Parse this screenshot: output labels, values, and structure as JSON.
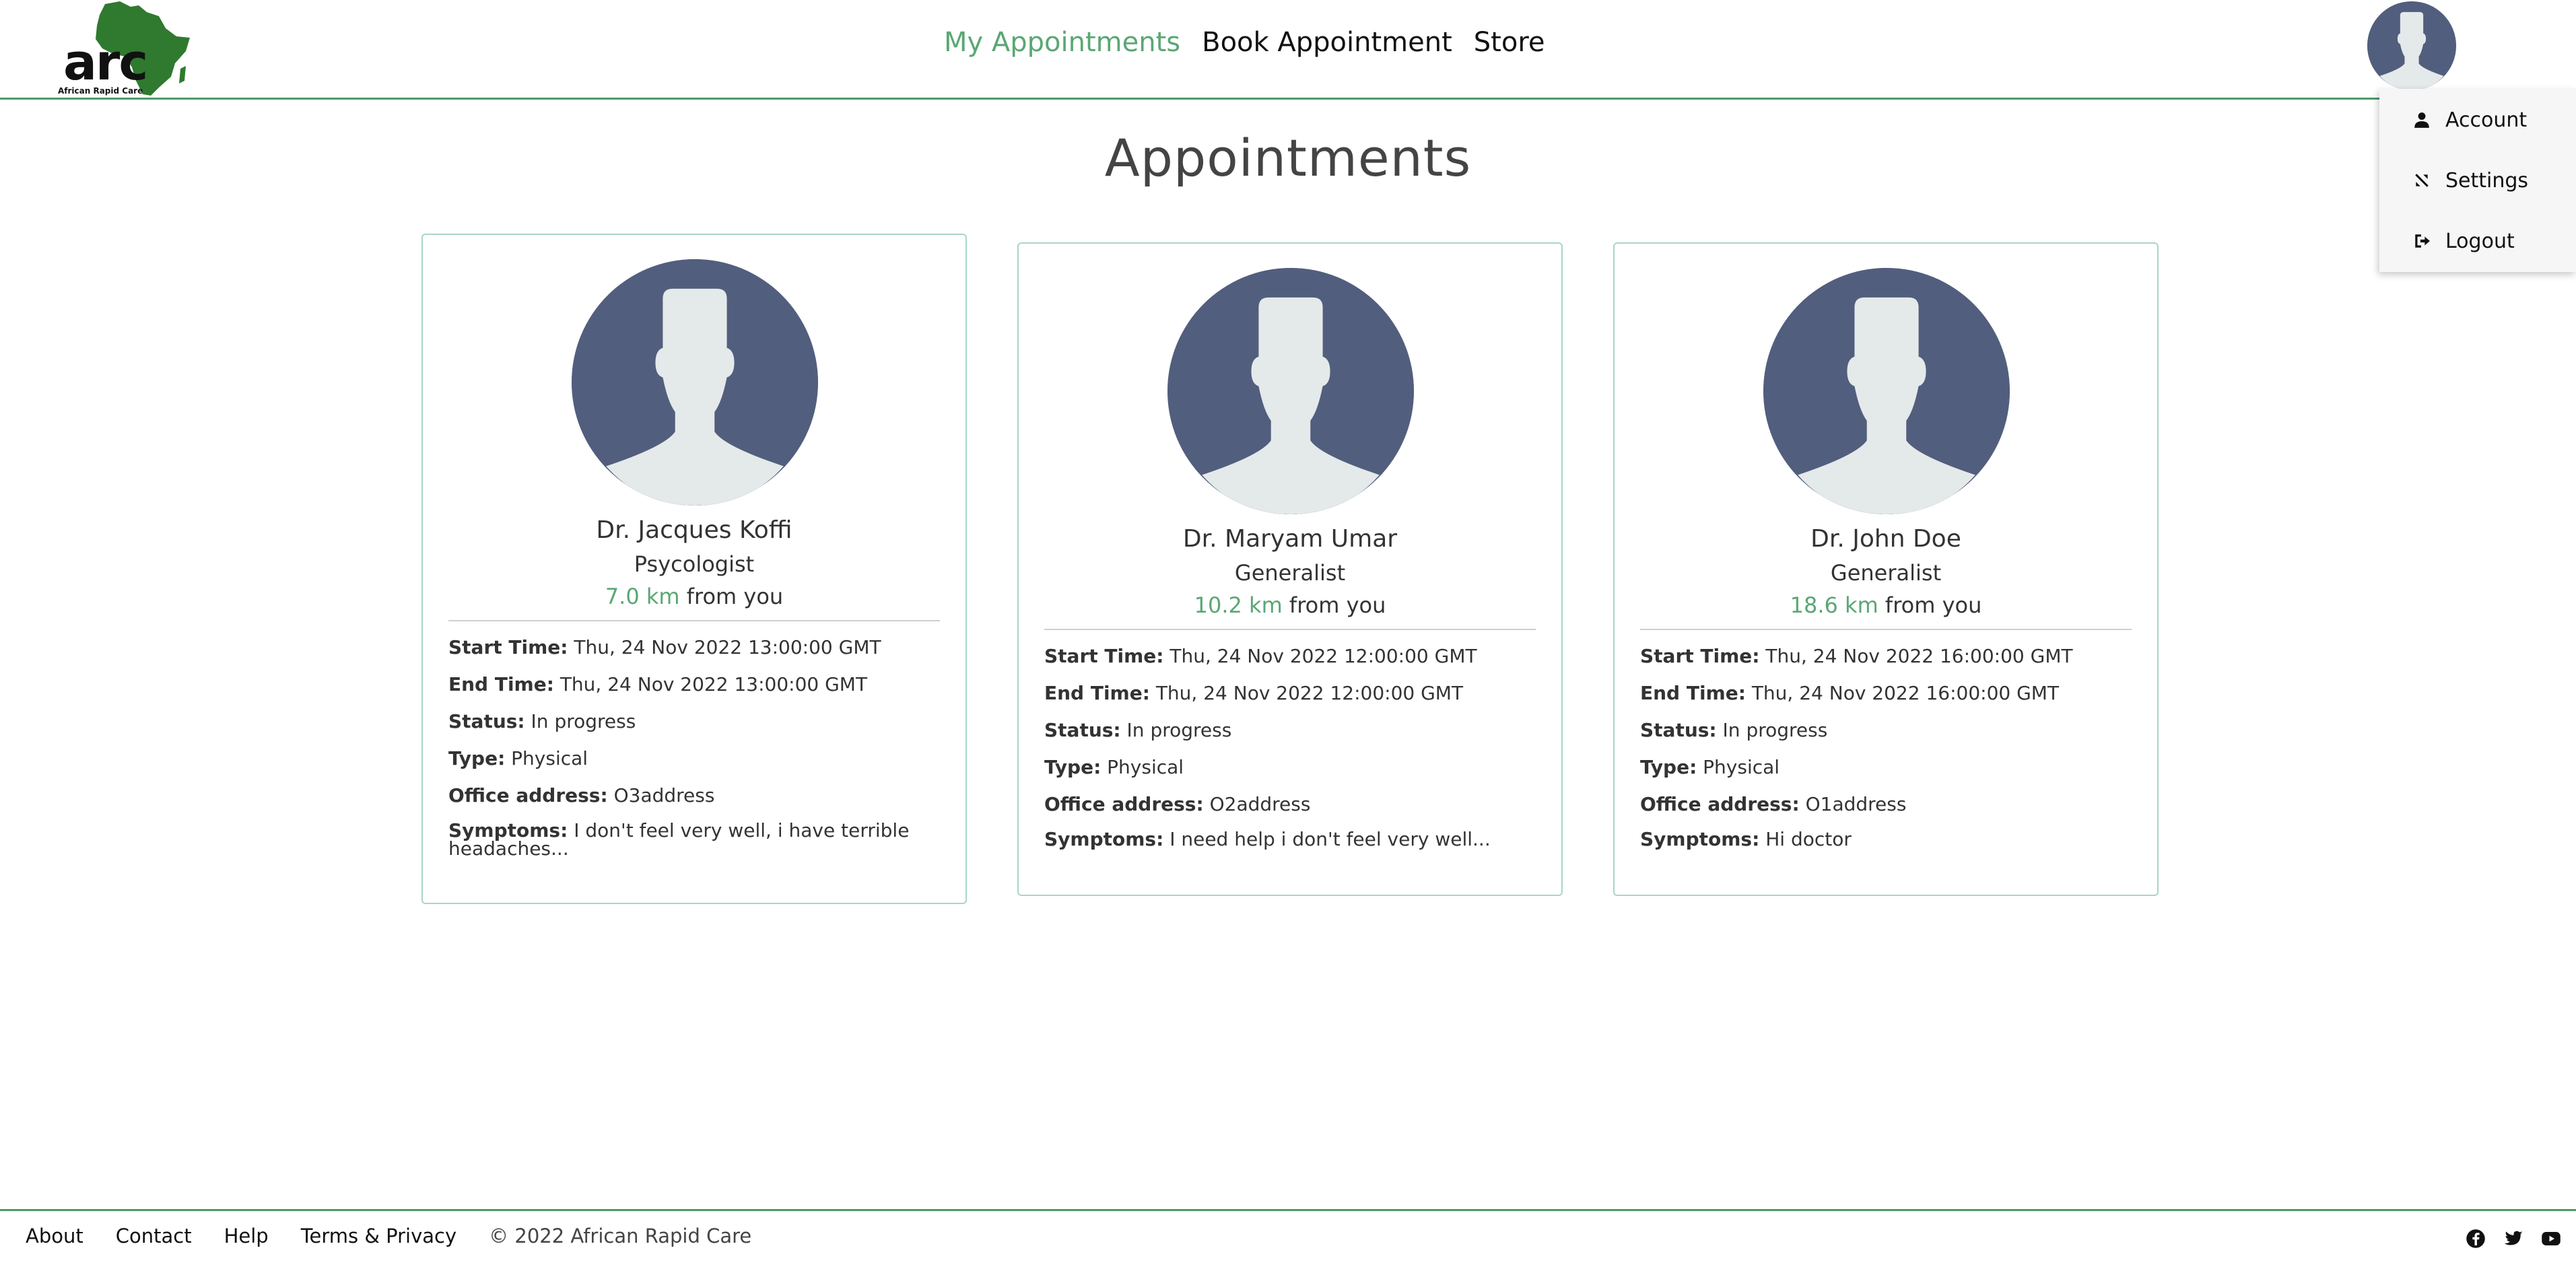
{
  "brand": {
    "logo_text": "arc",
    "logo_subtitle": "African Rapid Care",
    "accent_color": "#5aa774",
    "logo_color": "#2f7a2f"
  },
  "nav": {
    "items": [
      {
        "label": "My Appointments",
        "active": true
      },
      {
        "label": "Book Appointment",
        "active": false
      },
      {
        "label": "Store",
        "active": false
      }
    ]
  },
  "user_menu": {
    "items": [
      {
        "label": "Account",
        "icon": "user-icon"
      },
      {
        "label": "Settings",
        "icon": "tools-icon"
      },
      {
        "label": "Logout",
        "icon": "logout-icon"
      }
    ]
  },
  "page": {
    "title": "Appointments"
  },
  "labels": {
    "start_time": "Start Time:",
    "end_time": "End Time:",
    "status": "Status:",
    "type": "Type:",
    "office_address": "Office address:",
    "symptoms": "Symptoms:",
    "from_you": "from you"
  },
  "appointments": [
    {
      "doctor": "Dr. Jacques Koffi",
      "specialty": "Psycologist",
      "distance": "7.0 km",
      "start_time": "Thu, 24 Nov 2022 13:00:00 GMT",
      "end_time": "Thu, 24 Nov 2022 13:00:00 GMT",
      "status": "In progress",
      "type": "Physical",
      "office_address": "O3address",
      "symptoms": "I don't feel very well, i have terrible headaches..."
    },
    {
      "doctor": "Dr. Maryam Umar",
      "specialty": "Generalist",
      "distance": "10.2 km",
      "start_time": "Thu, 24 Nov 2022 12:00:00 GMT",
      "end_time": "Thu, 24 Nov 2022 12:00:00 GMT",
      "status": "In progress",
      "type": "Physical",
      "office_address": "O2address",
      "symptoms": "I need help i don't feel very well..."
    },
    {
      "doctor": "Dr. John Doe",
      "specialty": "Generalist",
      "distance": "18.6 km",
      "start_time": "Thu, 24 Nov 2022 16:00:00 GMT",
      "end_time": "Thu, 24 Nov 2022 16:00:00 GMT",
      "status": "In progress",
      "type": "Physical",
      "office_address": "O1address",
      "symptoms": "Hi doctor"
    }
  ],
  "footer": {
    "links": [
      "About",
      "Contact",
      "Help",
      "Terms & Privacy"
    ],
    "copyright": "© 2022 African Rapid Care",
    "social": [
      "facebook-icon",
      "twitter-icon",
      "youtube-icon"
    ]
  }
}
